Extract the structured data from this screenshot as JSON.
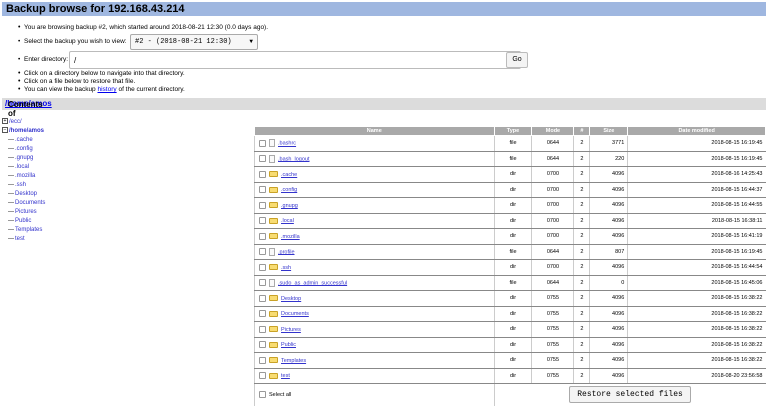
{
  "header": {
    "title": "Backup browse for 192.168.43.214"
  },
  "info": {
    "browsing": "You are browsing backup #2, which started around 2018-08-21 12:30 (0.0 days ago).",
    "select_label": "Select the backup you wish to view:",
    "select_value": "#2 - (2018-08-21 12:30)",
    "enter_dir_label": "Enter directory:",
    "dir_value": "/",
    "go_label": "Go",
    "nav_hint": "Click on a directory below to navigate into that directory.",
    "restore_hint": "Click on a file below to restore that file.",
    "history_prefix": "You can view the backup",
    "history_link": "history",
    "history_suffix": "of the current directory."
  },
  "contents": {
    "prefix": "Contents of",
    "path": "/home/amos"
  },
  "tree": {
    "root": "/ecc/",
    "home": "/home/amos",
    "children": [
      ".cache",
      ".config",
      ".gnupg",
      ".local",
      ".mozilla",
      ".ssh",
      "Desktop",
      "Documents",
      "Pictures",
      "Public",
      "Templates",
      "test"
    ]
  },
  "table": {
    "headers": {
      "name": "Name",
      "type": "Type",
      "mode": "Mode",
      "num": "#",
      "size": "Size",
      "date": "Date modified"
    },
    "rows": [
      {
        "name": ".bashrc",
        "type": "file",
        "mode": "0644",
        "num": "2",
        "size": "3771",
        "date": "2018-08-15 16:19:45"
      },
      {
        "name": ".bash_logout",
        "type": "file",
        "mode": "0644",
        "num": "2",
        "size": "220",
        "date": "2018-08-15 16:19:45"
      },
      {
        "name": ".cache",
        "type": "dir",
        "mode": "0700",
        "num": "2",
        "size": "4096",
        "date": "2018-08-16 14:25:43"
      },
      {
        "name": ".config",
        "type": "dir",
        "mode": "0700",
        "num": "2",
        "size": "4096",
        "date": "2018-08-15 16:44:37"
      },
      {
        "name": ".gnupg",
        "type": "dir",
        "mode": "0700",
        "num": "2",
        "size": "4096",
        "date": "2018-08-15 16:44:55"
      },
      {
        "name": ".local",
        "type": "dir",
        "mode": "0700",
        "num": "2",
        "size": "4096",
        "date": "2018-08-15 16:38:11"
      },
      {
        "name": ".mozilla",
        "type": "dir",
        "mode": "0700",
        "num": "2",
        "size": "4096",
        "date": "2018-08-15 16:41:19"
      },
      {
        "name": ".profile",
        "type": "file",
        "mode": "0644",
        "num": "2",
        "size": "807",
        "date": "2018-08-15 16:19:45"
      },
      {
        "name": ".ssh",
        "type": "dir",
        "mode": "0700",
        "num": "2",
        "size": "4096",
        "date": "2018-08-15 16:44:54"
      },
      {
        "name": ".sudo_as_admin_successful",
        "type": "file",
        "mode": "0644",
        "num": "2",
        "size": "0",
        "date": "2018-08-15 16:45:06"
      },
      {
        "name": "Desktop",
        "type": "dir",
        "mode": "0755",
        "num": "2",
        "size": "4096",
        "date": "2018-08-15 16:38:22"
      },
      {
        "name": "Documents",
        "type": "dir",
        "mode": "0755",
        "num": "2",
        "size": "4096",
        "date": "2018-08-15 16:38:22"
      },
      {
        "name": "Pictures",
        "type": "dir",
        "mode": "0755",
        "num": "2",
        "size": "4096",
        "date": "2018-08-15 16:38:22"
      },
      {
        "name": "Public",
        "type": "dir",
        "mode": "0755",
        "num": "2",
        "size": "4096",
        "date": "2018-08-15 16:38:22"
      },
      {
        "name": "Templates",
        "type": "dir",
        "mode": "0755",
        "num": "2",
        "size": "4096",
        "date": "2018-08-15 16:38:22"
      },
      {
        "name": "test",
        "type": "dir",
        "mode": "0755",
        "num": "2",
        "size": "4096",
        "date": "2018-08-20 23:56:58"
      }
    ],
    "select_all": "Select all",
    "restore_label": "Restore selected files"
  }
}
